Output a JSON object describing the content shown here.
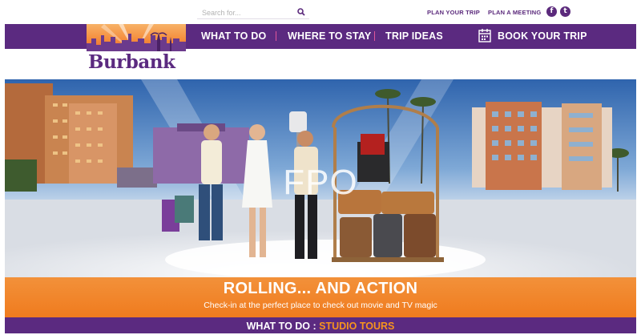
{
  "search": {
    "placeholder": "Search for..."
  },
  "utility_links": {
    "plan_trip": "PLAN YOUR TRIP",
    "plan_meeting": "PLAN A MEETING"
  },
  "social": {
    "facebook": "f",
    "twitter": "t"
  },
  "logo": {
    "text": "Burbank"
  },
  "nav": {
    "items": [
      "WHAT TO DO",
      "WHERE TO STAY",
      "TRIP IDEAS"
    ],
    "book": "BOOK YOUR TRIP"
  },
  "hero": {
    "placeholder_text": "FPO"
  },
  "caption": {
    "title": "ROLLING... AND ACTION",
    "subtitle": "Check-in at the perfect place to check out movie and TV magic"
  },
  "bottom_bar": {
    "prefix": "WHAT TO DO : ",
    "highlight": "STUDIO TOURS"
  },
  "colors": {
    "purple": "#5b2a80",
    "orange": "#f07b1e",
    "pink_separator": "#e0569a"
  },
  "icons": [
    "search-icon",
    "calendar-icon",
    "facebook-icon",
    "twitter-icon"
  ]
}
